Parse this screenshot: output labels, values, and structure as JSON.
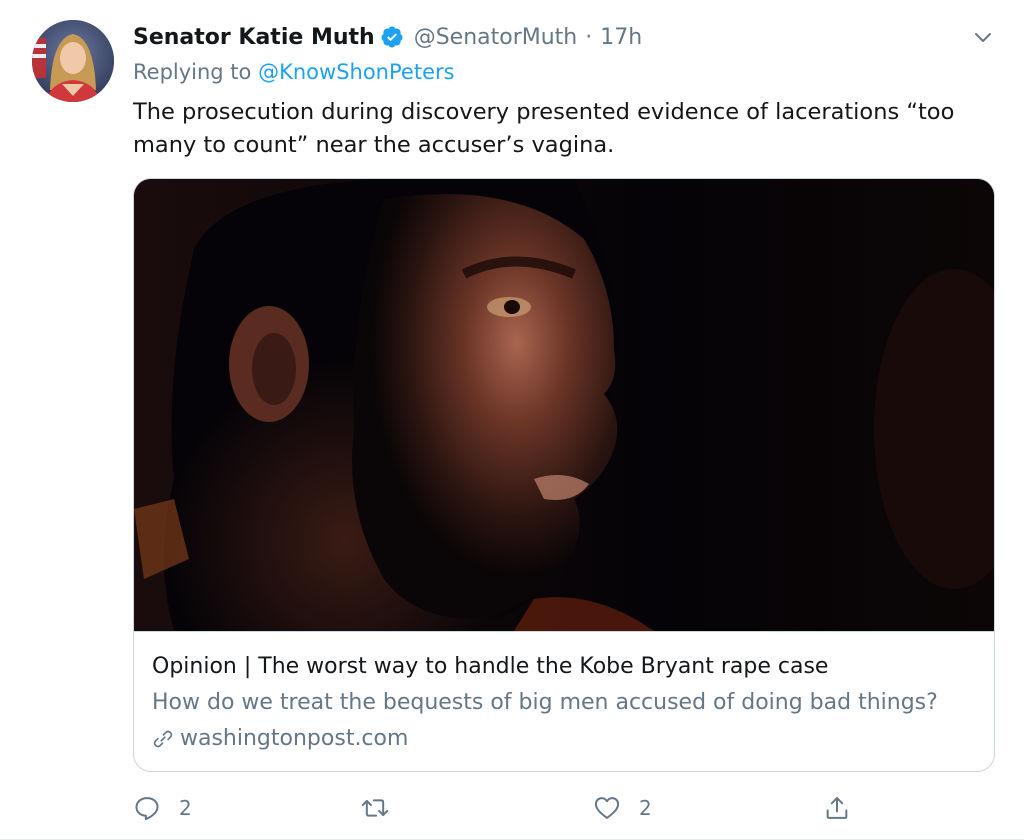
{
  "tweet": {
    "author_name": "Senator Katie Muth",
    "handle": "@SenatorMuth",
    "separator": "·",
    "time": "17h",
    "replying_prefix": "Replying to",
    "replying_to": "@KnowShonPeters",
    "text": "The prosecution during discovery presented evidence of lacerations “too many to count” near the accuser’s vagina.",
    "verified": true
  },
  "card": {
    "title": "Opinion | The worst way to handle the Kobe Bryant rape case",
    "description": "How do we treat the bequests of big men accused of doing bad things?",
    "domain": "washingtonpost.com"
  },
  "actions": {
    "reply_count": "2",
    "retweet_count": "",
    "like_count": "2"
  },
  "icons": {
    "verified": "verified-badge-icon",
    "caret": "chevron-down-icon",
    "link": "link-icon",
    "reply": "reply-icon",
    "retweet": "retweet-icon",
    "like": "heart-icon",
    "share": "share-icon"
  },
  "colors": {
    "accent": "#1da1f2",
    "text_primary": "#14171a",
    "text_secondary": "#657786",
    "border": "#ccd6dd"
  }
}
